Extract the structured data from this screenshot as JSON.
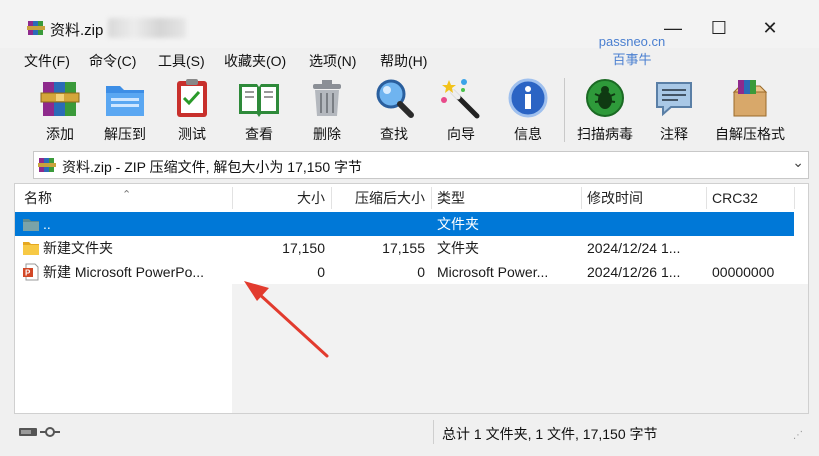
{
  "window": {
    "title": "资料.zip",
    "controls": {
      "minimize": "—",
      "maximize": "☐",
      "close": "✕"
    }
  },
  "watermark": {
    "line1": "passneo.cn",
    "line2": "百事牛"
  },
  "menu": [
    "文件(F)",
    "命令(C)",
    "工具(S)",
    "收藏夹(O)",
    "选项(N)",
    "帮助(H)"
  ],
  "toolbar": [
    {
      "label": "添加",
      "icon": "archive-books-icon"
    },
    {
      "label": "解压到",
      "icon": "folder-extract-icon"
    },
    {
      "label": "测试",
      "icon": "clipboard-check-icon"
    },
    {
      "label": "查看",
      "icon": "open-book-icon"
    },
    {
      "label": "删除",
      "icon": "trash-can-icon"
    },
    {
      "label": "查找",
      "icon": "magnifier-icon"
    },
    {
      "label": "向导",
      "icon": "magic-wand-icon"
    },
    {
      "label": "信息",
      "icon": "info-icon"
    },
    {
      "label": "扫描病毒",
      "icon": "virus-scan-icon"
    },
    {
      "label": "注释",
      "icon": "comment-icon"
    },
    {
      "label": "自解压格式",
      "icon": "sfx-box-icon"
    }
  ],
  "address": {
    "text": "资料.zip - ZIP 压缩文件, 解包大小为 17,150 字节"
  },
  "columns": [
    "名称",
    "大小",
    "压缩后大小",
    "类型",
    "修改时间",
    "CRC32"
  ],
  "rows": [
    {
      "name": "..",
      "size": "",
      "packed": "",
      "type": "文件夹",
      "modified": "",
      "crc": "",
      "icon": "parent-folder-icon",
      "selected": true
    },
    {
      "name": "新建文件夹",
      "size": "17,150",
      "packed": "17,155",
      "type": "文件夹",
      "modified": "2024/12/24 1...",
      "crc": "",
      "icon": "folder-icon",
      "selected": false
    },
    {
      "name": "新建 Microsoft PowerPo...",
      "size": "0",
      "packed": "0",
      "type": "Microsoft Power...",
      "modified": "2024/12/26 1...",
      "crc": "00000000",
      "icon": "powerpoint-file-icon",
      "selected": false
    }
  ],
  "status": {
    "summary": "总计 1 文件夹, 1 文件, 17,150 字节"
  },
  "colors": {
    "selection": "#0078d7",
    "arrow": "#e23b2e",
    "watermark": "#4a7fd0"
  }
}
